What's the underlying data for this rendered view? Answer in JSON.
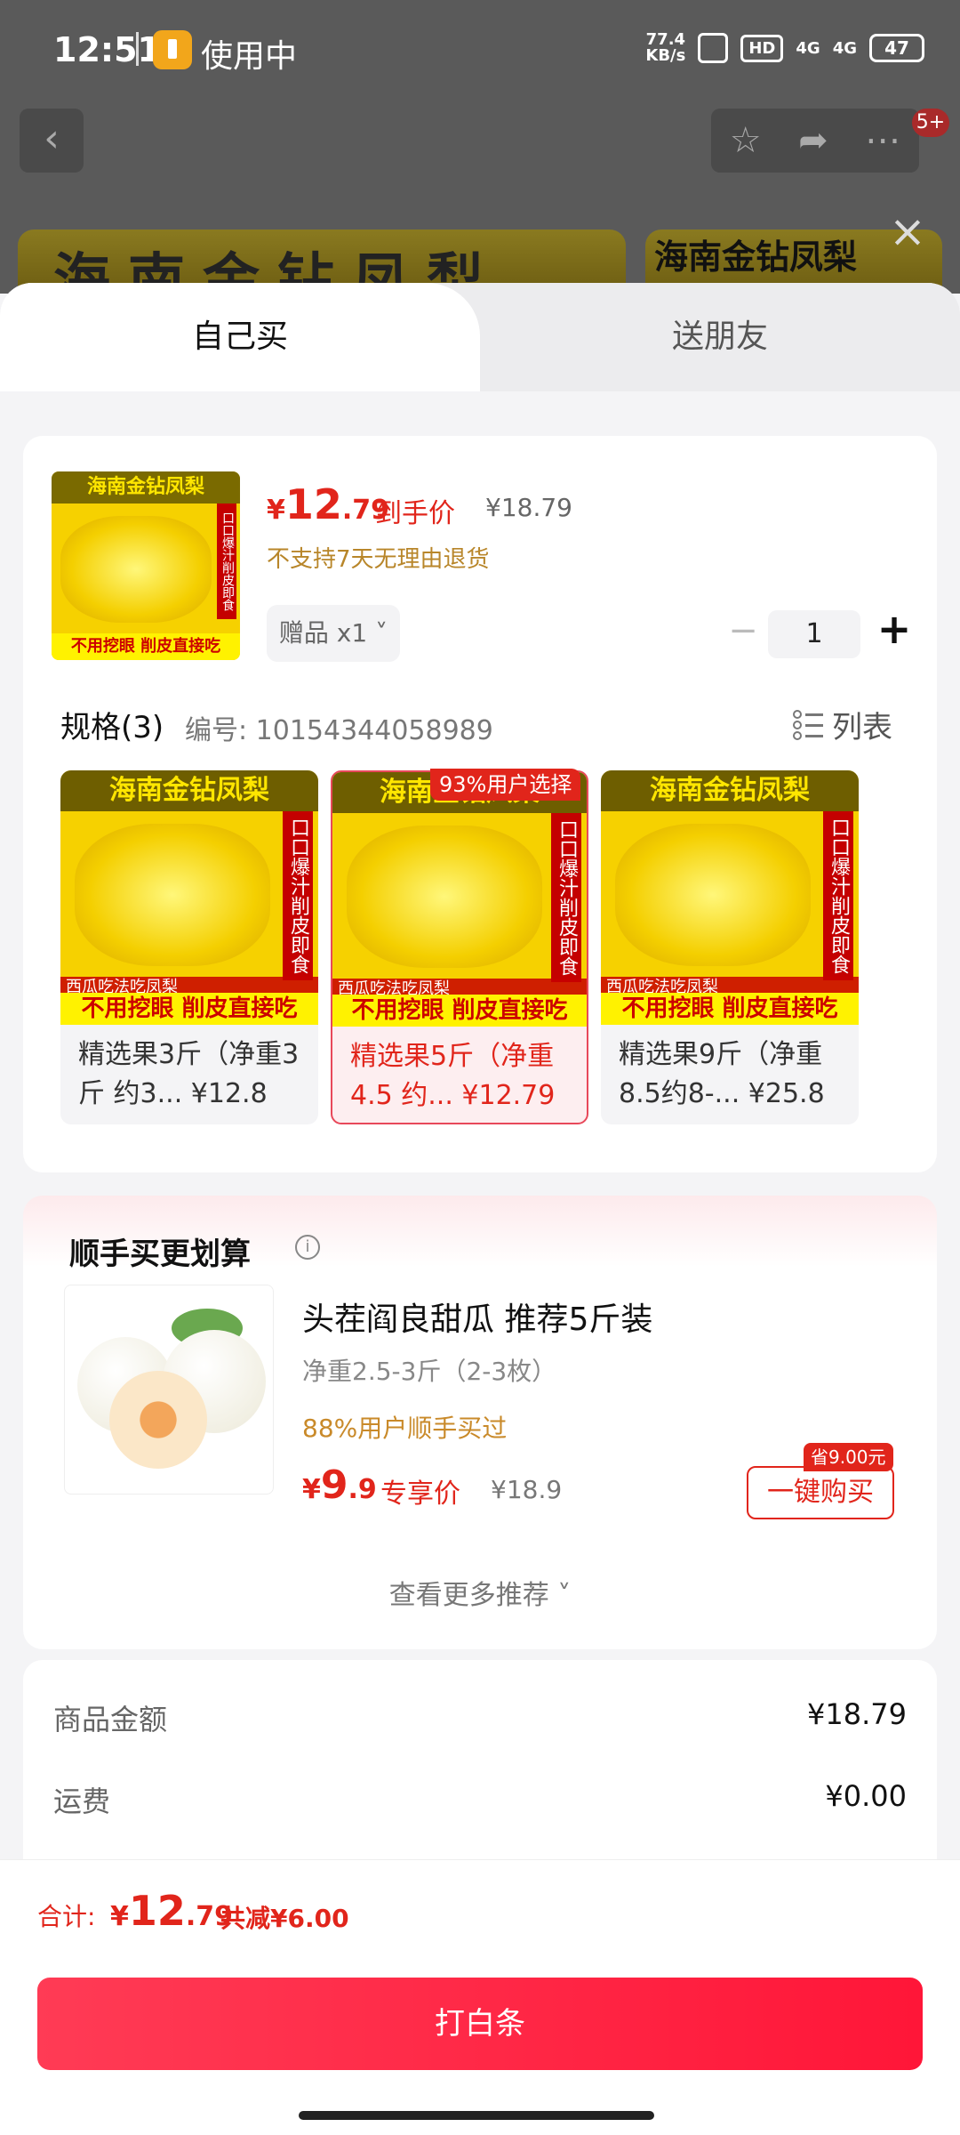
{
  "status_bar": {
    "time": "12:51",
    "app_status": "使用中",
    "net_speed_value": "77.4",
    "net_speed_unit": "KB/s",
    "hd": "HD",
    "signal1": "4G",
    "signal2": "4G",
    "battery": "47"
  },
  "topbar": {
    "back_icon": "chevron-left-icon",
    "badge": "5+"
  },
  "background": {
    "banner_left": "海南金钻凤梨",
    "banner_right": "海南金钻凤梨"
  },
  "tabs": [
    {
      "label": "自己买",
      "active": true
    },
    {
      "label": "送朋友",
      "active": false
    }
  ],
  "product": {
    "thumb_title": "海南金钻凤梨",
    "thumb_side": "口口爆汁削皮即食",
    "thumb_caption": "西瓜吃法吃凤梨",
    "thumb_bottom": "不用挖眼 削皮直接吃",
    "price_symbol": "¥",
    "price_int": "12",
    "price_dec": ".79",
    "price_label": "到手价",
    "original_price": "¥18.79",
    "no_return": "不支持7天无理由退货",
    "gift_label": "赠品 x1 ˅",
    "quantity": "1",
    "qty_minus": "−",
    "qty_plus": "+"
  },
  "spec": {
    "title": "规格(3)",
    "code": "编号: 10154344058989",
    "list_label": "列表",
    "variants": [
      {
        "title": "海南金钻凤梨",
        "side": "口口爆汁削皮即食",
        "caption": "西瓜吃法吃凤梨",
        "bottom": "不用挖眼 削皮直接吃",
        "text": "精选果3斤（净重3斤 约3... ¥12.8",
        "selected": false
      },
      {
        "title": "海南金钻凤梨",
        "side": "口口爆汁削皮即食",
        "caption": "西瓜吃法吃凤梨",
        "bottom": "不用挖眼 削皮直接吃",
        "text": "精选果5斤（净重4.5 约... ¥12.79",
        "selected": true
      },
      {
        "title": "海南金钻凤梨",
        "side": "口口爆汁削皮即食",
        "caption": "西瓜吃法吃凤梨",
        "bottom": "不用挖眼 削皮直接吃",
        "text": "精选果9斤（净重8.5约8-... ¥25.8",
        "selected": false
      }
    ],
    "selected_badge": "93%用户选择"
  },
  "upsell": {
    "title": "顺手买更划算",
    "info_icon": "i",
    "name": "头茬阎良甜瓜 推荐5斤装",
    "weight": "净重2.5-3斤（2-3枚）",
    "social_proof": "88%用户顺手买过",
    "price_symbol": "¥",
    "price_int": "9",
    "price_dec": ".9",
    "price_label": "专享价",
    "original_price": "¥18.9",
    "save_badge": "省9.00元",
    "buy_button": "一键购买",
    "see_more": "查看更多推荐 ˅"
  },
  "summary": {
    "rows": [
      {
        "label": "商品金额",
        "value": "¥18.79"
      },
      {
        "label": "运费",
        "value": "¥0.00"
      }
    ]
  },
  "bottom": {
    "total_label": "合计:",
    "total_symbol": "¥",
    "total_int": "12",
    "total_dec": ".79",
    "total_save": "共减¥6.00",
    "pay_button": "打白条"
  },
  "colors": {
    "accent_red": "#e1251b",
    "pay_gradient_start": "#ff3b55",
    "pay_gradient_end": "#ff1638",
    "social_gold": "#c98a2a"
  }
}
